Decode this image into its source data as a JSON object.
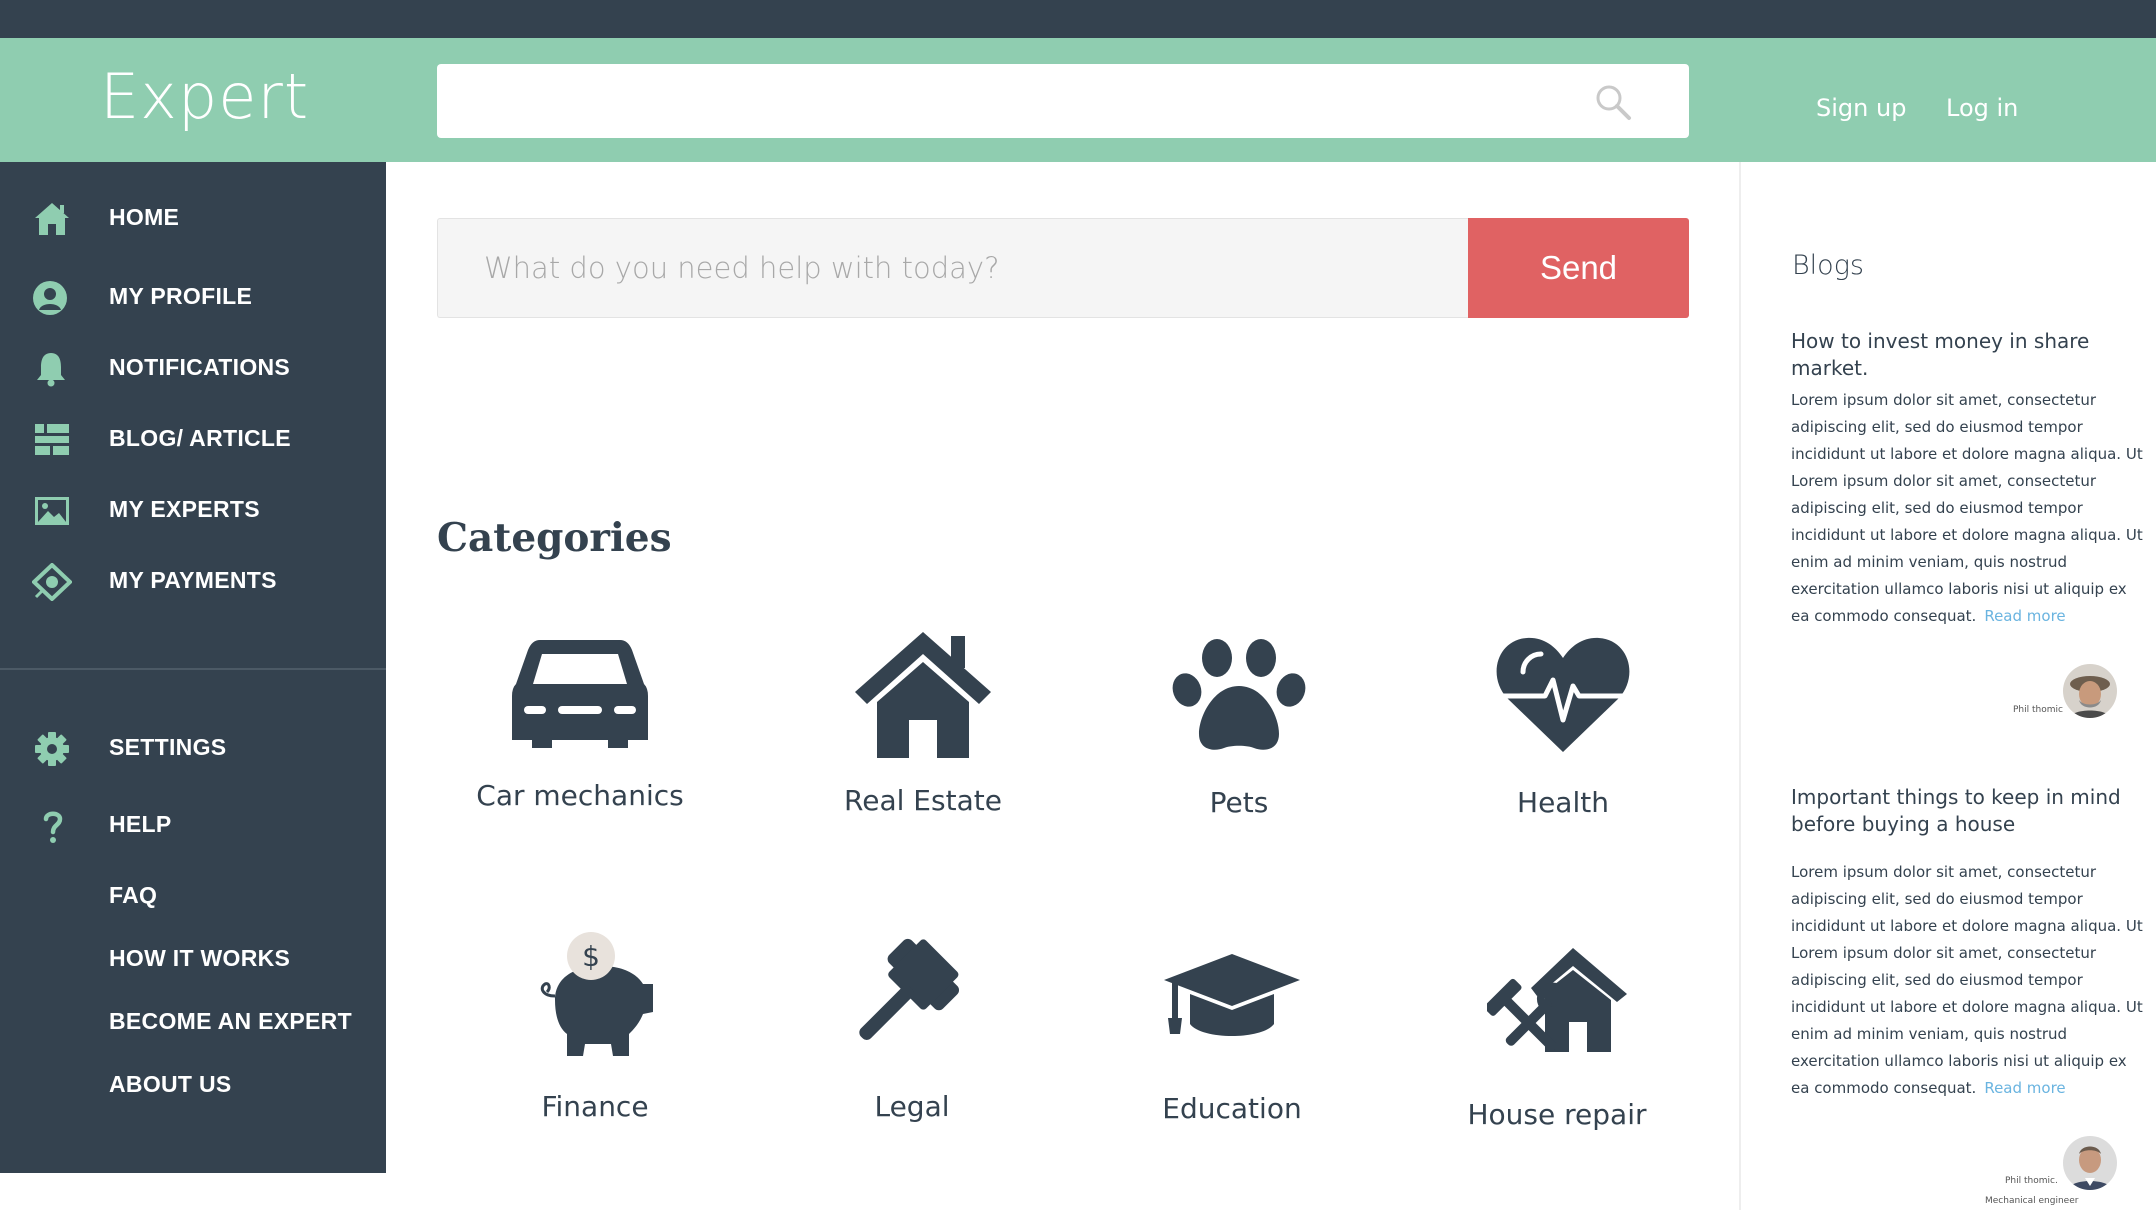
{
  "header": {
    "logo": "Expert",
    "search": {
      "value": "",
      "placeholder": ""
    },
    "signup": "Sign up",
    "login": "Log in"
  },
  "sidebar": {
    "items": [
      {
        "label": "HOME",
        "icon": "home-icon"
      },
      {
        "label": "MY PROFILE",
        "icon": "user-icon"
      },
      {
        "label": "NOTIFICATIONS",
        "icon": "bell-icon"
      },
      {
        "label": "BLOG/ ARTICLE",
        "icon": "list-icon"
      },
      {
        "label": "MY EXPERTS",
        "icon": "image-icon"
      },
      {
        "label": "MY PAYMENTS",
        "icon": "payment-icon"
      }
    ],
    "bottom_items": [
      {
        "label": "SETTINGS",
        "icon": "gear-icon"
      },
      {
        "label": "HELP",
        "icon": "question-icon"
      },
      {
        "label": "FAQ"
      },
      {
        "label": "HOW IT WORKS"
      },
      {
        "label": "BECOME AN EXPERT"
      },
      {
        "label": "ABOUT US"
      }
    ]
  },
  "ask": {
    "placeholder": "What do you need help with today?",
    "value": "",
    "send_label": "Send"
  },
  "categories": {
    "heading": "Categories",
    "items": [
      {
        "label": "Car mechanics",
        "icon": "car-icon"
      },
      {
        "label": "Real Estate",
        "icon": "house-icon"
      },
      {
        "label": "Pets",
        "icon": "paw-icon"
      },
      {
        "label": "Health",
        "icon": "heartbeat-icon"
      },
      {
        "label": "Finance",
        "icon": "piggy-bank-icon"
      },
      {
        "label": "Legal",
        "icon": "gavel-icon"
      },
      {
        "label": "Education",
        "icon": "graduation-cap-icon"
      },
      {
        "label": "House repair",
        "icon": "house-repair-icon"
      }
    ]
  },
  "blogs": {
    "heading": "Blogs",
    "posts": [
      {
        "title": "How to invest money in share market.",
        "body": "Lorem ipsum dolor sit amet, consectetur adipiscing elit, sed do eiusmod tempor incididunt ut labore et dolore magna aliqua. Ut Lorem ipsum dolor sit amet, consectetur adipiscing elit, sed do eiusmod tempor incididunt ut labore et dolore magna aliqua. Ut enim ad minim veniam, quis nostrud exercitation ullamco laboris nisi ut aliquip ex ea commodo consequat.",
        "read_more": "Read more",
        "author": "Phil thomic",
        "role": ""
      },
      {
        "title": "Important things to keep in mind before buying a house",
        "body": "Lorem ipsum dolor sit amet, consectetur adipiscing elit, sed do eiusmod tempor incididunt ut labore et dolore magna aliqua. Ut Lorem ipsum dolor sit amet, consectetur adipiscing elit, sed do eiusmod tempor incididunt ut labore et dolore magna aliqua. Ut enim ad minim veniam, quis nostrud exercitation ullamco laboris nisi ut aliquip ex ea commodo consequat.",
        "read_more": "Read more",
        "author": "Phil thomic.",
        "role": "Mechanical engineer"
      }
    ]
  },
  "colors": {
    "header": "#8fcdb0",
    "sidebar": "#34424f",
    "accent_icon": "#8fcdb0",
    "send": "#e06263",
    "link": "#6ab4e0"
  }
}
